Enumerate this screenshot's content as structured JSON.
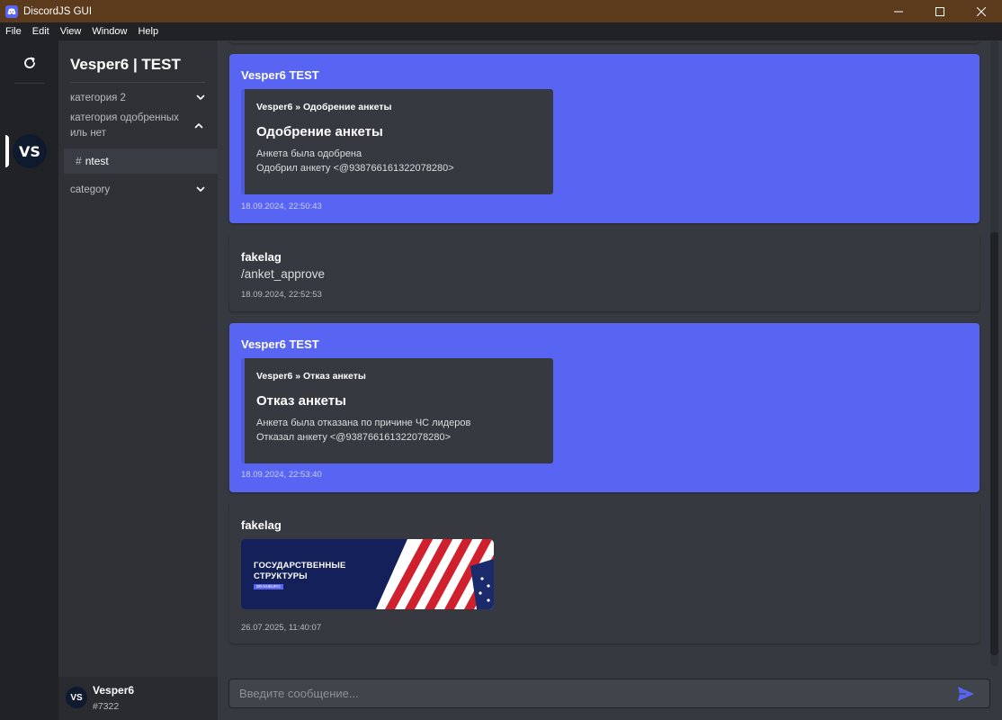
{
  "window": {
    "title": "DiscordJS GUI"
  },
  "menu": [
    "File",
    "Edit",
    "View",
    "Window",
    "Help"
  ],
  "rail": {
    "server_initials": "VS"
  },
  "sidebar": {
    "server_name": "Vesper6 | TEST",
    "categories": [
      {
        "label": "категория 2",
        "state": "collapsed"
      },
      {
        "label": "категория одобренных иль нет",
        "state": "expanded"
      },
      {
        "label": "category",
        "state": "collapsed"
      }
    ],
    "channels": [
      {
        "hash": "#",
        "label": "ntest",
        "selected": true
      }
    ]
  },
  "user": {
    "initials": "VS",
    "name": "Vesper6",
    "tag": "#7322"
  },
  "messages": [
    {
      "author": "Vesper6 TEST",
      "embed": {
        "author": "Vesper6 » Одобрение анкеты",
        "title": "Одобрение анкеты",
        "line1": "Анкета была одобрена",
        "line2": "Одобрил анкету <@938766161322078280>"
      },
      "time": "18.09.2024, 22:50:43"
    },
    {
      "author": "fakelag",
      "content": "/anket_approve",
      "time": "18.09.2024, 22:52:53"
    },
    {
      "author": "Vesper6 TEST",
      "embed": {
        "author": "Vesper6 » Отказ анкеты",
        "title": "Отказ анкеты",
        "line1": "Анкета была отказана по причине ЧС лидеров",
        "line2": "Отказал анкету <@938766161322078280>"
      },
      "time": "18.09.2024, 22:53:40"
    },
    {
      "author": "fakelag",
      "attachment": {
        "line1": "ГОСУДАРСТВЕННЫЕ",
        "line2": "СТРУКТУРЫ",
        "badge": "BRAINBURG"
      },
      "time": "26.07.2025, 11:40:07"
    }
  ],
  "composer": {
    "placeholder": "Введите сообщение..."
  },
  "colors": {
    "accent": "#5865f2",
    "titlebar": "#5c3a1c",
    "background": "#36393f"
  }
}
